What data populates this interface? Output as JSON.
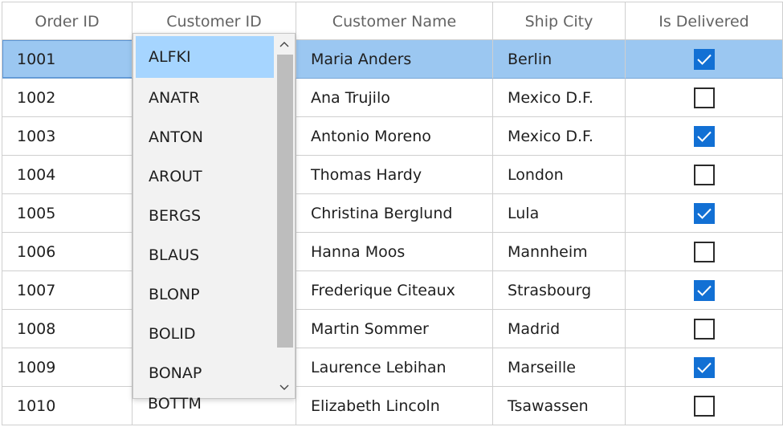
{
  "columns": {
    "order_id": "Order ID",
    "customer_id": "Customer ID",
    "customer_name": "Customer Name",
    "ship_city": "Ship City",
    "is_delivered": "Is Delivered"
  },
  "rows": [
    {
      "order_id": "1001",
      "customer_name": "Maria Anders",
      "ship_city": "Berlin",
      "delivered": true
    },
    {
      "order_id": "1002",
      "customer_name": "Ana Trujilo",
      "ship_city": "Mexico D.F.",
      "delivered": false
    },
    {
      "order_id": "1003",
      "customer_name": "Antonio Moreno",
      "ship_city": "Mexico D.F.",
      "delivered": true
    },
    {
      "order_id": "1004",
      "customer_name": "Thomas Hardy",
      "ship_city": "London",
      "delivered": false
    },
    {
      "order_id": "1005",
      "customer_name": "Christina Berglund",
      "ship_city": "Lula",
      "delivered": true
    },
    {
      "order_id": "1006",
      "customer_name": "Hanna Moos",
      "ship_city": "Mannheim",
      "delivered": false
    },
    {
      "order_id": "1007",
      "customer_name": "Frederique Citeaux",
      "ship_city": "Strasbourg",
      "delivered": true
    },
    {
      "order_id": "1008",
      "customer_name": "Martin Sommer",
      "ship_city": "Madrid",
      "delivered": false
    },
    {
      "order_id": "1009",
      "customer_name": "Laurence Lebihan",
      "ship_city": "Marseille",
      "delivered": true
    },
    {
      "order_id": "1010",
      "customer_name": "Elizabeth Lincoln",
      "ship_city": "Tsawassen",
      "delivered": false
    }
  ],
  "dropdown": {
    "items": [
      "ALFKI",
      "ANATR",
      "ANTON",
      "AROUT",
      "BERGS",
      "BLAUS",
      "BLONP",
      "BOLID",
      "BONAP"
    ],
    "selected": "ALFKI",
    "partial_item": "BOTTM"
  },
  "colors": {
    "selected_row": "#9bc7f1",
    "dropdown_selected": "#a6d5ff",
    "checkbox_checked": "#1270d4"
  },
  "icons": {
    "scroll_up": "chevron-up-icon",
    "scroll_down": "chevron-down-icon",
    "check": "checkmark-icon"
  }
}
